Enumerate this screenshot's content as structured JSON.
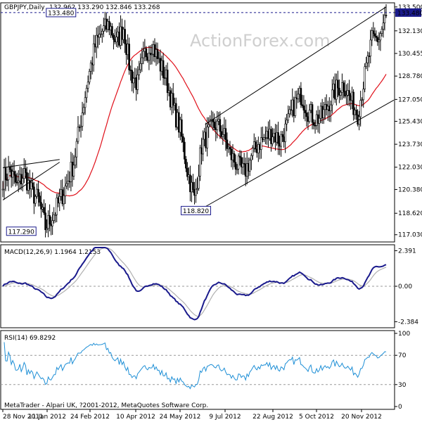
{
  "chart_data": {
    "type": "candlestick",
    "symbol_header": "GBPJPY,Daily",
    "ohlc_header": "132.962 133.290 132.846 133.268",
    "watermark": "ActionForex.com",
    "footer": "MetaTrader - Alpari UK, ?2001-2012, MetaQuotes Software Corp.",
    "price_axis_ticks": [
      "133.480",
      "133.500",
      "132.130",
      "130.455",
      "128.780",
      "127.050",
      "125.430",
      "123.730",
      "122.030",
      "120.380",
      "118.620",
      "117.030"
    ],
    "current_price": "133.480",
    "x_tick_labels": [
      "28 Nov 2011",
      "11 Jan 2012",
      "24 Feb 2012",
      "10 Apr 2012",
      "24 May 2012",
      "9 Jul 2012",
      "22 Aug 2012",
      "5 Oct 2012",
      "20 Nov 2012"
    ],
    "annotations": [
      {
        "text": "133.480",
        "kind": "high"
      },
      {
        "text": "118.820",
        "kind": "low"
      },
      {
        "text": "117.290",
        "kind": "low"
      }
    ],
    "price_ylim": [
      116.6,
      134.1
    ],
    "close_path": [
      [
        "28 Nov 2011",
        121.2
      ],
      [
        "5 Dec 2011",
        121.8
      ],
      [
        "12 Dec 2011",
        120.6
      ],
      [
        "19 Dec 2011",
        121.6
      ],
      [
        "26 Dec 2011",
        120.2
      ],
      [
        "2 Jan 2012",
        119.6
      ],
      [
        "9 Jan 2012",
        117.6
      ],
      [
        "16 Jan 2012",
        118.4
      ],
      [
        "23 Jan 2012",
        119.5
      ],
      [
        "30 Jan 2012",
        120.8
      ],
      [
        "6 Feb 2012",
        122.4
      ],
      [
        "13 Feb 2012",
        125.6
      ],
      [
        "20 Feb 2012",
        128.6
      ],
      [
        "27 Feb 2012",
        131.0
      ],
      [
        "5 Mar 2012",
        132.1
      ],
      [
        "12 Mar 2012",
        132.6
      ],
      [
        "19 Mar 2012",
        131.2
      ],
      [
        "26 Mar 2012",
        132.4
      ],
      [
        "2 Apr 2012",
        129.0
      ],
      [
        "9 Apr 2012",
        128.2
      ],
      [
        "16 Apr 2012",
        130.4
      ],
      [
        "23 Apr 2012",
        131.2
      ],
      [
        "30 Apr 2012",
        129.8
      ],
      [
        "7 May 2012",
        128.6
      ],
      [
        "14 May 2012",
        126.4
      ],
      [
        "21 May 2012",
        124.8
      ],
      [
        "28 May 2012",
        121.8
      ],
      [
        "4 Jun 2012",
        119.6
      ],
      [
        "11 Jun 2012",
        123.6
      ],
      [
        "18 Jun 2012",
        124.6
      ],
      [
        "25 Jun 2012",
        125.2
      ],
      [
        "2 Jul 2012",
        124.6
      ],
      [
        "9 Jul 2012",
        123.0
      ],
      [
        "16 Jul 2012",
        122.2
      ],
      [
        "23 Jul 2012",
        121.6
      ],
      [
        "30 Jul 2012",
        122.8
      ],
      [
        "6 Aug 2012",
        123.8
      ],
      [
        "13 Aug 2012",
        124.2
      ],
      [
        "20 Aug 2012",
        124.6
      ],
      [
        "27 Aug 2012",
        124.0
      ],
      [
        "3 Sep 2012",
        125.0
      ],
      [
        "10 Sep 2012",
        126.6
      ],
      [
        "17 Sep 2012",
        127.4
      ],
      [
        "24 Sep 2012",
        126.2
      ],
      [
        "1 Oct 2012",
        125.6
      ],
      [
        "8 Oct 2012",
        125.8
      ],
      [
        "15 Oct 2012",
        126.9
      ],
      [
        "22 Oct 2012",
        127.8
      ],
      [
        "29 Oct 2012",
        128.2
      ],
      [
        "5 Nov 2012",
        127.0
      ],
      [
        "12 Nov 2012",
        126.0
      ],
      [
        "19 Nov 2012",
        128.8
      ],
      [
        "26 Nov 2012",
        131.4
      ],
      [
        "3 Dec 2012",
        131.6
      ],
      [
        "10 Dec 2012",
        133.27
      ]
    ],
    "macd": {
      "label": "MACD(12,26,9) 1.1964 1.2153",
      "ticks": [
        "2.391",
        "0.00",
        "-2.384"
      ],
      "ylim": [
        -2.6,
        2.6
      ]
    },
    "rsi": {
      "label": "RSI(14) 69.8292",
      "ticks": [
        "100",
        "70",
        "30",
        "0"
      ],
      "ylim": [
        0,
        100
      ]
    }
  }
}
